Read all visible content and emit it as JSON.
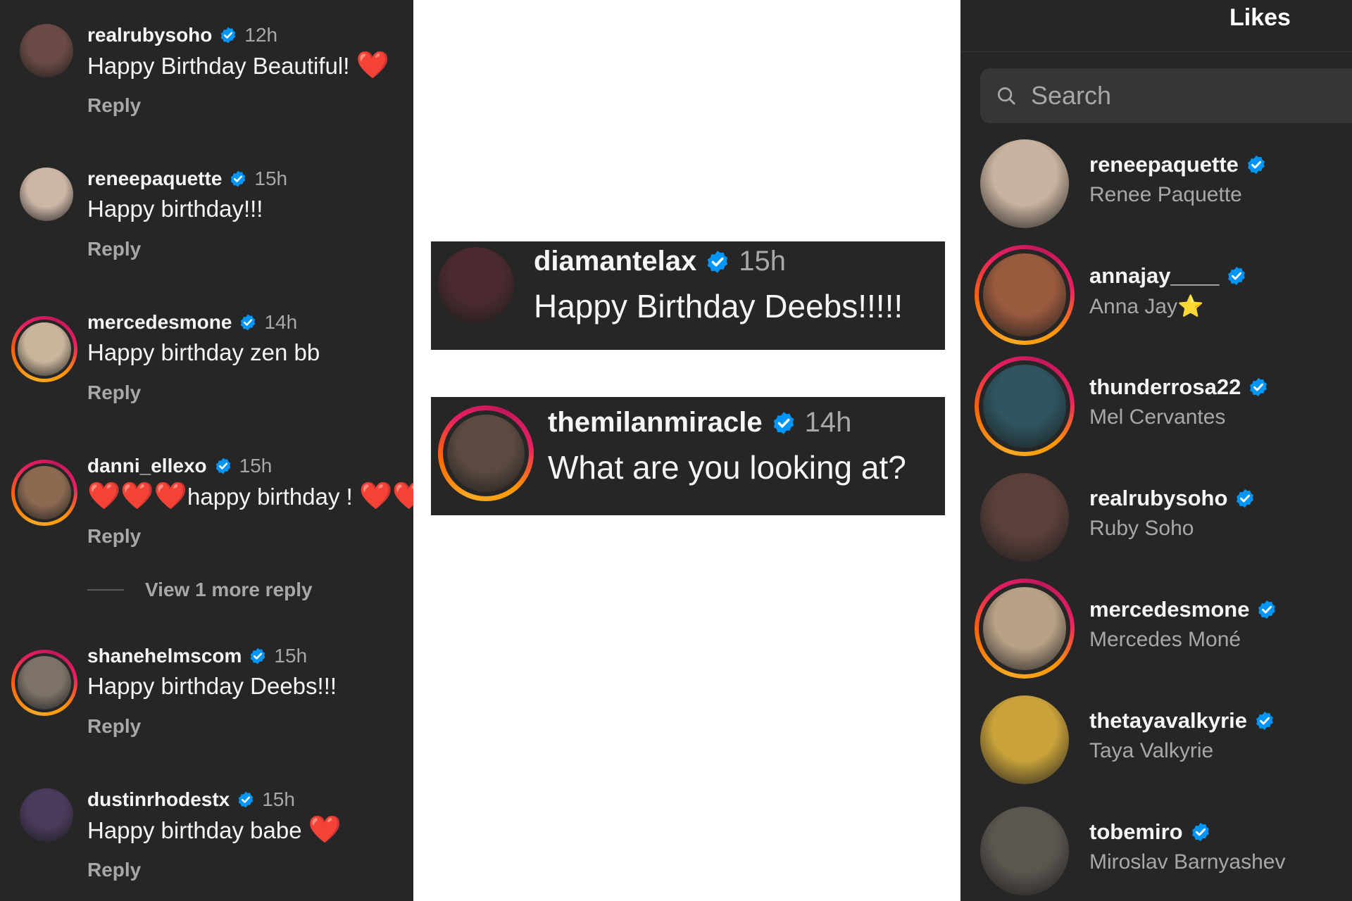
{
  "comments": [
    {
      "username": "realrubysoho",
      "time": "12h",
      "text": "Happy Birthday Beautiful!",
      "hearts_after": 1,
      "reply": "Reply",
      "story_ring": false,
      "avatar_color": "#6a4a44"
    },
    {
      "username": "reneepaquette",
      "time": "15h",
      "text": "Happy birthday!!!",
      "hearts_after": 0,
      "reply": "Reply",
      "story_ring": false,
      "avatar_color": "#cdb6a6"
    },
    {
      "username": "mercedesmone",
      "time": "14h",
      "text": "Happy birthday zen bb",
      "hearts_after": 0,
      "reply": "Reply",
      "story_ring": true,
      "avatar_color": "#c9b59b"
    },
    {
      "username": "danni_ellexo",
      "time": "15h",
      "text": "happy birthday !",
      "hearts_before": 3,
      "hearts_after": 2,
      "reply": "Reply",
      "story_ring": true,
      "avatar_color": "#8c6a52"
    },
    {
      "username": "shanehelmscom",
      "time": "15h",
      "text": "Happy birthday Deebs!!!",
      "hearts_after": 0,
      "reply": "Reply",
      "story_ring": true,
      "avatar_color": "#7d7268"
    },
    {
      "username": "dustinrhodestx",
      "time": "15h",
      "text": "Happy birthday babe",
      "hearts_after": 1,
      "reply": "Reply",
      "story_ring": false,
      "avatar_color": "#4a3a5c"
    }
  ],
  "view_more_replies": "View 1 more reply",
  "cards": [
    {
      "username": "diamantelax",
      "time": "15h",
      "text": "Happy Birthday Deebs!!!!!",
      "story_ring": false,
      "avatar_color": "#4a2a2e"
    },
    {
      "username": "themilanmiracle",
      "time": "14h",
      "text": "What are you looking at?",
      "story_ring": true,
      "avatar_color": "#5b4a40"
    }
  ],
  "likes": {
    "title": "Likes",
    "search_placeholder": "Search",
    "users": [
      {
        "username": "reneepaquette",
        "full_name": "Renee Paquette",
        "story_ring": false,
        "avatar_color": "#c9b3a0"
      },
      {
        "username": "annajay____",
        "full_name": "Anna Jay",
        "full_name_emoji": "⭐",
        "story_ring": true,
        "avatar_color": "#9a5a3e"
      },
      {
        "username": "thunderrosa22",
        "full_name": "Mel Cervantes",
        "story_ring": true,
        "avatar_color": "#2e5560"
      },
      {
        "username": "realrubysoho",
        "full_name": "Ruby Soho",
        "story_ring": false,
        "avatar_color": "#5a3f3a"
      },
      {
        "username": "mercedesmone",
        "full_name": "Mercedes Moné",
        "story_ring": true,
        "avatar_color": "#b8a186"
      },
      {
        "username": "thetayavalkyrie",
        "full_name": "Taya Valkyrie",
        "story_ring": false,
        "avatar_color": "#c9a23a"
      },
      {
        "username": "tobemiro",
        "full_name": "Miroslav Barnyashev",
        "story_ring": false,
        "avatar_color": "#5c5650"
      }
    ]
  },
  "colors": {
    "panel_bg": "#262626",
    "verified_blue": "#0095f6",
    "heart_red": "#e5192f",
    "muted_text": "#a8a8a8"
  }
}
